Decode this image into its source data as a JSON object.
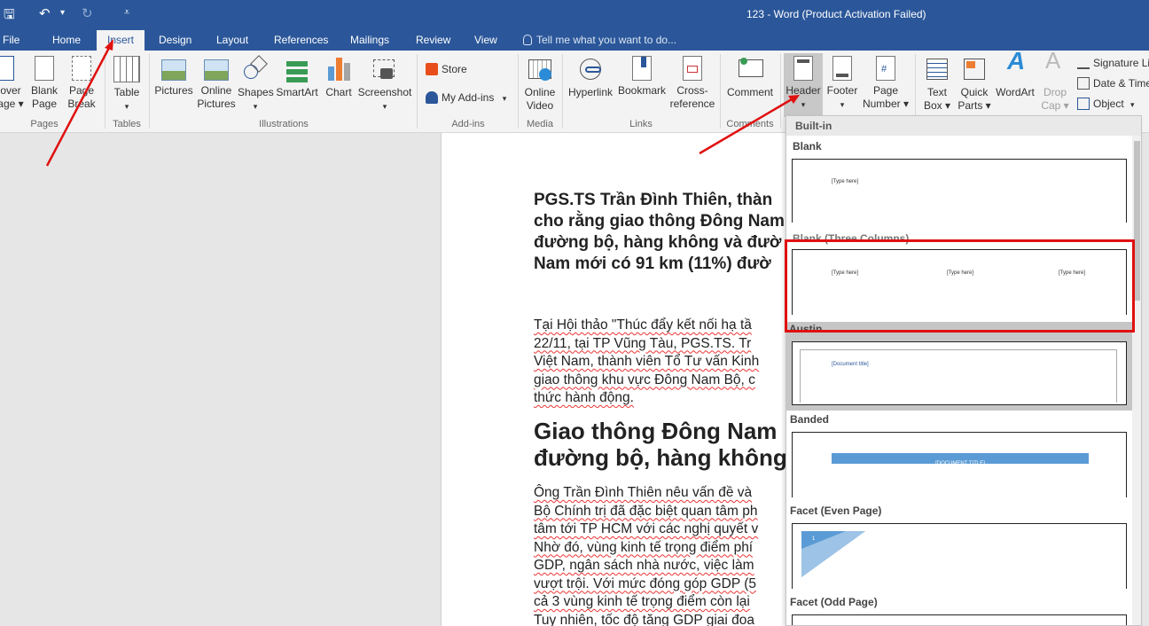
{
  "titlebar": {
    "title": "123 - Word (Product Activation Failed)",
    "save_glyph": "🖫",
    "undo_glyph": "↶",
    "undo_arrow": "▾",
    "redo_glyph": "↻",
    "customize_glyph": "⩡"
  },
  "tabs": {
    "file": "File",
    "home": "Home",
    "insert": "Insert",
    "design": "Design",
    "layout": "Layout",
    "references": "References",
    "mailings": "Mailings",
    "review": "Review",
    "view": "View",
    "tellme": "Tell me what you want to do..."
  },
  "ribbon": {
    "pages": {
      "label": "Pages",
      "cover_line1": "over",
      "cover_line2": "age ▾",
      "blank_line1": "Blank",
      "blank_line2": "Page",
      "break_line1": "Page",
      "break_line2": "Break"
    },
    "tables": {
      "label": "Tables",
      "table_line1": "Table",
      "table_line2": "▾"
    },
    "illustrations": {
      "label": "Illustrations",
      "pictures": "Pictures",
      "online_line1": "Online",
      "online_line2": "Pictures",
      "shapes_line1": "Shapes",
      "shapes_line2": "▾",
      "smartart": "SmartArt",
      "chart": "Chart",
      "screenshot_line1": "Screenshot",
      "screenshot_line2": "▾"
    },
    "addins": {
      "label": "Add-ins",
      "store": "Store",
      "myaddins": "My Add-ins",
      "myaddins_arrow": "▾"
    },
    "media": {
      "label": "Media",
      "video_line1": "Online",
      "video_line2": "Video"
    },
    "links": {
      "label": "Links",
      "hyperlink": "Hyperlink",
      "bookmark": "Bookmark",
      "crossref_line1": "Cross-",
      "crossref_line2": "reference"
    },
    "comments": {
      "label": "Comments",
      "comment": "Comment"
    },
    "headerfooter": {
      "header_line1": "Header",
      "header_line2": "▾",
      "footer_line1": "Footer",
      "footer_line2": "▾",
      "pagenum_line1": "Page",
      "pagenum_line2": "Number ▾"
    },
    "text": {
      "textbox_line1": "Text",
      "textbox_line2": "Box ▾",
      "quickparts_line1": "Quick",
      "quickparts_line2": "Parts ▾",
      "wordart": "WordArt",
      "dropcap_line1": "Drop",
      "dropcap_line2": "Cap ▾",
      "signature": "Signature Li",
      "datetime": "Date & Time",
      "object": "Object",
      "object_arrow": "▾"
    }
  },
  "document": {
    "para1": [
      "PGS.TS Trần Đình Thiên, thàn",
      "cho rằng giao thông Đông Nam",
      "đường bộ, hàng không và đườ",
      "Nam mới có 91 km (11%) đườ"
    ],
    "para2": [
      "Tại Hội thảo \"Thúc đẩy kết nối hạ tầ",
      "22/11, tại TP Vũng Tàu, PGS.TS. Tr",
      "Việt Nam, thành viên Tổ Tư vấn Kinh",
      "giao thông khu vực Đông Nam Bộ, c",
      "thức hành động."
    ],
    "heading": [
      "Giao thông Đông Nam",
      "đường bộ, hàng không"
    ],
    "para3": [
      "Ông Trần Đình Thiên nêu vấn đề và",
      "Bộ Chính trị đã đặc biệt quan tâm ph",
      "tâm tới TP HCM với các nghị quyết v",
      "Nhờ đó, vùng kinh tế trọng điểm phí",
      "GDP, ngân sách nhà nước, việc làm",
      "vượt trội. Với mức đóng góp GDP (5",
      "cả 3 vùng kinh tế trọng điểm còn lại",
      "Tuy nhiên, tốc độ tăng GDP giai đoa"
    ]
  },
  "gallery": {
    "section": "Built-in",
    "blank": {
      "label": "Blank",
      "placeholder": "[Type here]"
    },
    "three_columns": {
      "label": "Blank (Three Columns)",
      "col1": "[Type here]",
      "col2": "[Type here]",
      "col3": "[Type here]"
    },
    "austin": {
      "label": "Austin",
      "placeholder": "[Document title]"
    },
    "banded": {
      "label": "Banded",
      "placeholder": "[DOCUMENT TITLE]"
    },
    "facet_even": {
      "label": "Facet (Even Page)",
      "placeholder": "1"
    },
    "facet_odd": {
      "label": "Facet (Odd Page)"
    }
  },
  "colors": {
    "word_blue": "#2b579a",
    "annotation_red": "#e01010",
    "banded_blue": "#5b9bd5"
  }
}
